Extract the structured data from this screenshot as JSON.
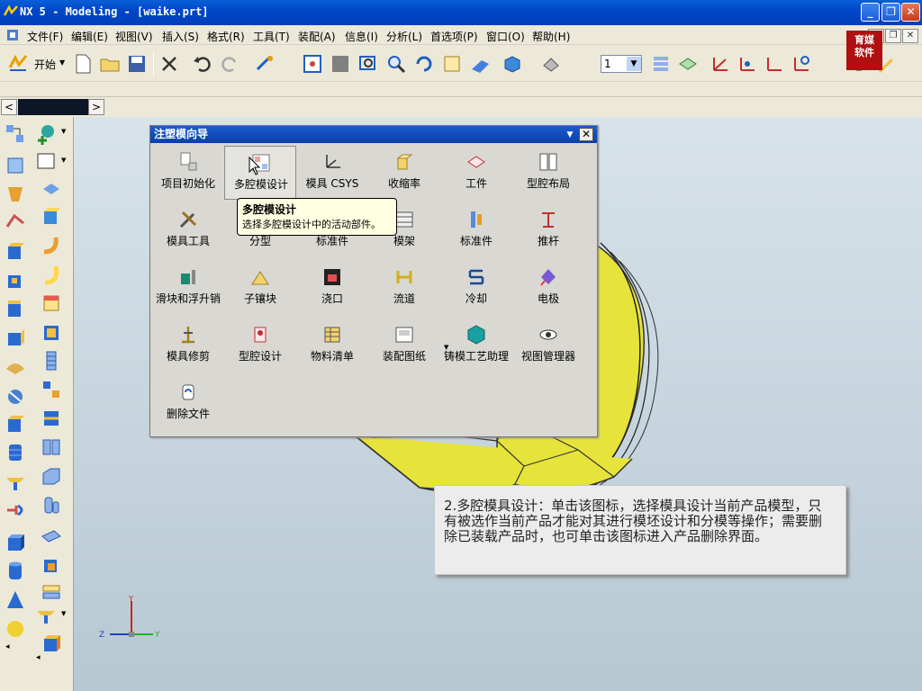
{
  "window": {
    "title": "NX 5 - Modeling - [waike.prt]"
  },
  "menu": {
    "items": [
      {
        "label": "文件(F)"
      },
      {
        "label": "编辑(E)"
      },
      {
        "label": "视图(V)"
      },
      {
        "label": "插入(S)"
      },
      {
        "label": "格式(R)"
      },
      {
        "label": "工具(T)"
      },
      {
        "label": "装配(A)"
      },
      {
        "label": "信息(I)"
      },
      {
        "label": "分析(L)"
      },
      {
        "label": "首选项(P)"
      },
      {
        "label": "窗口(O)"
      },
      {
        "label": "帮助(H)"
      }
    ]
  },
  "toolbar": {
    "start_label": "开始",
    "layer_value": "1"
  },
  "badge": {
    "line1": "育媒",
    "line2": "软件"
  },
  "dialog": {
    "title": "注塑模向导",
    "tiles": [
      {
        "label": "项目初始化",
        "icon": "project-init-icon"
      },
      {
        "label": "多腔模设计",
        "icon": "multi-cavity-icon"
      },
      {
        "label": "模具 CSYS",
        "icon": "mold-csys-icon"
      },
      {
        "label": "收缩率",
        "icon": "shrinkage-icon"
      },
      {
        "label": "工件",
        "icon": "workpiece-icon"
      },
      {
        "label": "型腔布局",
        "icon": "cavity-layout-icon"
      },
      {
        "label": "模具工具",
        "icon": "mold-tools-icon"
      },
      {
        "label": "分型",
        "icon": "parting-icon"
      },
      {
        "label": "标准件",
        "icon": "standard-part-icon"
      },
      {
        "label": "模架",
        "icon": "mold-base-icon"
      },
      {
        "label": "标准件",
        "icon": "standard-part-2-icon"
      },
      {
        "label": "推杆",
        "icon": "ejector-pin-icon"
      },
      {
        "label": "滑块和浮升销",
        "icon": "slider-lifter-icon"
      },
      {
        "label": "子镶块",
        "icon": "sub-insert-icon"
      },
      {
        "label": "浇口",
        "icon": "gate-icon"
      },
      {
        "label": "流道",
        "icon": "runner-icon"
      },
      {
        "label": "冷却",
        "icon": "cooling-icon"
      },
      {
        "label": "电极",
        "icon": "electrode-icon"
      },
      {
        "label": "模具修剪",
        "icon": "mold-trim-icon"
      },
      {
        "label": "型腔设计",
        "icon": "cavity-design-icon"
      },
      {
        "label": "物料清单",
        "icon": "bom-icon"
      },
      {
        "label": "装配图纸",
        "icon": "assembly-drawing-icon"
      },
      {
        "label": "铸模工艺助理",
        "icon": "casting-assistant-icon"
      },
      {
        "label": "视图管理器",
        "icon": "view-manager-icon"
      },
      {
        "label": "删除文件",
        "icon": "delete-file-icon"
      }
    ]
  },
  "tooltip": {
    "title": "多腔模设计",
    "text": "选择多腔模设计中的活动部件。"
  },
  "note": {
    "text": "2.多腔模具设计：单击该图标，选择模具设计当前产品模型，只有被选作当前产品才能对其进行模坯设计和分模等操作；需要删除已装载产品时，也可单击该图标进入产品删除界面。"
  },
  "axis": {
    "x_label": "Z",
    "y_label": "Y",
    "z_label": "Y"
  },
  "colors": {
    "title_bar": "#0a4fd0",
    "model_yellow": "#f0ee3c",
    "dialog_title": "#1a5ccc"
  }
}
